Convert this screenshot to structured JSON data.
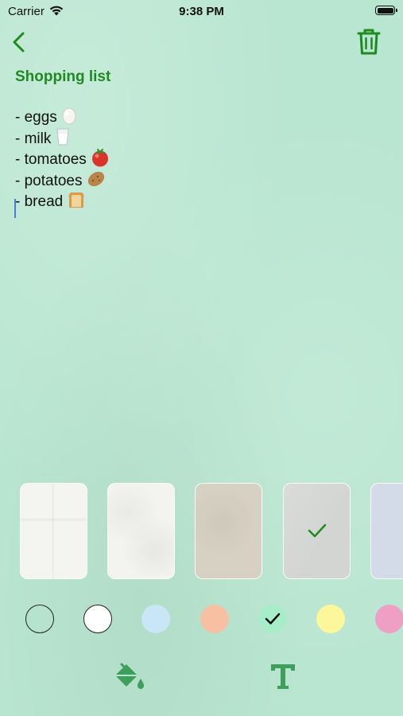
{
  "status_bar": {
    "carrier": "Carrier",
    "time": "9:38 PM"
  },
  "nav": {
    "back_icon": "chevron-left-icon",
    "delete_icon": "trash-icon",
    "accent_color": "#1f8a1f"
  },
  "note": {
    "title": "Shopping list",
    "lines": [
      {
        "text": "- eggs",
        "emoji": "egg"
      },
      {
        "text": "- milk",
        "emoji": "glass-of-milk"
      },
      {
        "text": "- tomatoes",
        "emoji": "tomato"
      },
      {
        "text": "- potatoes",
        "emoji": "potato"
      },
      {
        "text": "- bread",
        "emoji": "bread"
      }
    ]
  },
  "background_color": "#b9e6d1",
  "paper_textures": [
    {
      "name": "white-tiles",
      "selected": false
    },
    {
      "name": "white-crumpled",
      "selected": false
    },
    {
      "name": "beige-recycled",
      "selected": false
    },
    {
      "name": "gray-crumpled",
      "selected": true
    },
    {
      "name": "light-blue",
      "selected": false
    }
  ],
  "colors": [
    {
      "name": "clear",
      "hex": "transparent",
      "selected": false
    },
    {
      "name": "white",
      "hex": "#ffffff",
      "selected": false
    },
    {
      "name": "light-blue",
      "hex": "#c9e6f7",
      "selected": false
    },
    {
      "name": "peach",
      "hex": "#f7c0a2",
      "selected": false
    },
    {
      "name": "mint",
      "hex": "#a7edc9",
      "selected": true
    },
    {
      "name": "yellow",
      "hex": "#fbf79a",
      "selected": false
    },
    {
      "name": "pink",
      "hex": "#ef9ec4",
      "selected": false
    }
  ],
  "toolbar": {
    "fill_icon": "paint-bucket-icon",
    "text_icon": "text-format-icon"
  }
}
